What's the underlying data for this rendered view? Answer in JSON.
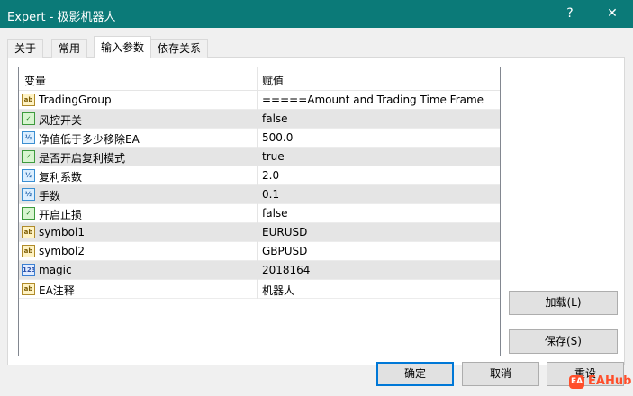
{
  "window": {
    "title": "Expert - 极影机器人",
    "help_glyph": "?",
    "close_glyph": "✕",
    "titlebar_color": "#0b7a78"
  },
  "tabs": [
    {
      "label": "关于",
      "active": false
    },
    {
      "label": "常用",
      "active": false
    },
    {
      "label": "输入参数",
      "active": true
    },
    {
      "label": "依存关系",
      "active": false
    }
  ],
  "grid": {
    "headers": {
      "variable": "变量",
      "value": "赋值"
    },
    "rows": [
      {
        "icon": "ab",
        "type": "string",
        "name": "TradingGroup",
        "value": "=====Amount and Trading Time Frame"
      },
      {
        "icon": "bool",
        "type": "bool",
        "name": "风控开关",
        "value": "false"
      },
      {
        "icon": "V2",
        "type": "double",
        "name": "净值低于多少移除EA",
        "value": "500.0"
      },
      {
        "icon": "bool",
        "type": "bool",
        "name": "是否开启复利模式",
        "value": "true"
      },
      {
        "icon": "V2",
        "type": "double",
        "name": "复利系数",
        "value": "2.0"
      },
      {
        "icon": "V2",
        "type": "double",
        "name": "手数",
        "value": "0.1"
      },
      {
        "icon": "bool",
        "type": "bool",
        "name": "开启止损",
        "value": "false"
      },
      {
        "icon": "ab",
        "type": "string",
        "name": "symbol1",
        "value": "EURUSD"
      },
      {
        "icon": "ab",
        "type": "string",
        "name": "symbol2",
        "value": "GBPUSD"
      },
      {
        "icon": "123",
        "type": "int",
        "name": "magic",
        "value": "2018164"
      },
      {
        "icon": "ab",
        "type": "string",
        "name": "EA注释",
        "value": "机器人"
      }
    ]
  },
  "buttons": {
    "load": "加载(L)",
    "save": "保存(S)",
    "ok": "确定",
    "cancel": "取消",
    "reset": "重设"
  },
  "watermark": {
    "icon": "EA",
    "text": "EAHub"
  }
}
